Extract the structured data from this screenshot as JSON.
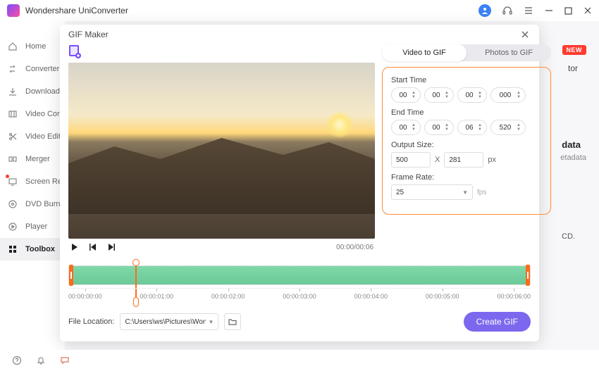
{
  "app": {
    "title": "Wondershare UniConverter"
  },
  "titlebar_icons": {
    "avatar": "●",
    "headset": "headset",
    "menu": "≡",
    "min": "–",
    "max": "□",
    "close": "✕"
  },
  "sidebar": {
    "items": [
      {
        "label": "Home",
        "icon": "home"
      },
      {
        "label": "Converter",
        "icon": "convert"
      },
      {
        "label": "Downloader",
        "icon": "download"
      },
      {
        "label": "Video Compressor",
        "icon": "compress"
      },
      {
        "label": "Video Editor",
        "icon": "scissors"
      },
      {
        "label": "Merger",
        "icon": "merge"
      },
      {
        "label": "Screen Recorder",
        "icon": "record"
      },
      {
        "label": "DVD Burner",
        "icon": "dvd"
      },
      {
        "label": "Player",
        "icon": "play"
      },
      {
        "label": "Toolbox",
        "icon": "grid"
      }
    ]
  },
  "bg": {
    "new": "NEW",
    "t1": "tor",
    "t2": "data",
    "t3": "etadata",
    "t4": "CD."
  },
  "modal": {
    "title": "GIF Maker",
    "tabs": {
      "video": "Video to GIF",
      "photos": "Photos to GIF"
    },
    "playback_time": "00:00/00:06",
    "settings": {
      "start_label": "Start Time",
      "start": {
        "h": "00",
        "m": "00",
        "s": "00",
        "ms": "000"
      },
      "end_label": "End Time",
      "end": {
        "h": "00",
        "m": "00",
        "s": "06",
        "ms": "520"
      },
      "output_label": "Output Size:",
      "width": "500",
      "x": "X",
      "height": "281",
      "px": "px",
      "fr_label": "Frame Rate:",
      "fr_value": "25",
      "fps": "fps"
    },
    "timeline": {
      "ticks": [
        "00:00:00:00",
        "00:00:01:00",
        "00:00:02:00",
        "00:00:03:00",
        "00:00:04:00",
        "00:00:05:00",
        "00:00:06:00"
      ]
    },
    "footer": {
      "label": "File Location:",
      "path": "C:\\Users\\ws\\Pictures\\Wonders",
      "create": "Create GIF"
    }
  }
}
